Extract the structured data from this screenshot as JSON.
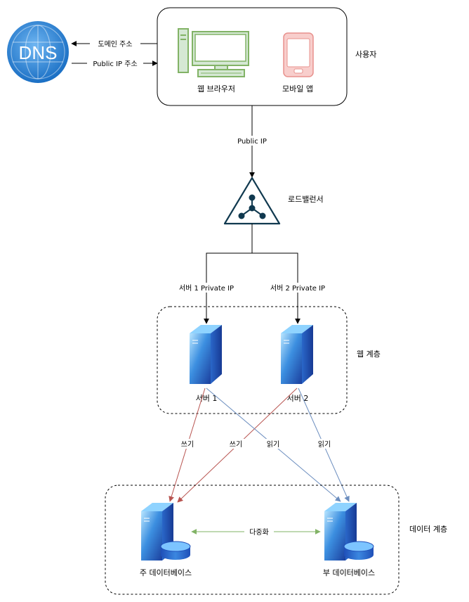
{
  "dns": {
    "label": "DNS"
  },
  "arrows": {
    "domain_label": "도메인 주소",
    "public_ip_addr_label": "Public IP 주소",
    "public_ip_label": "Public IP",
    "server1_private_ip": "서버 1 Private IP",
    "server2_private_ip": "서버 2 Private IP",
    "write1": "쓰기",
    "write2": "쓰기",
    "read1": "읽기",
    "read2": "읽기",
    "replication": "다중화"
  },
  "users": {
    "group_label": "사용자",
    "web_browser": "웹 브라우저",
    "mobile_app": "모바일 앱"
  },
  "load_balancer": {
    "label": "로드밸런서"
  },
  "web_tier": {
    "group_label": "웹 계층",
    "server1": "서버 1",
    "server2": "서버 2"
  },
  "data_tier": {
    "group_label": "데이터 계층",
    "master_db": "주 데이터베이스",
    "slave_db": "부 데이터베이스"
  },
  "colors": {
    "write": "#b85450",
    "read": "#6c8ebf",
    "replication": "#82b366",
    "lb": "#10394f",
    "browser": "#82b366",
    "mobile": "#f8cecc"
  }
}
